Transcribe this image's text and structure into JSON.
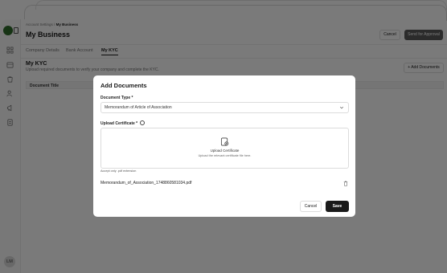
{
  "breadcrumb": {
    "parent": "Account Settings",
    "separator": "/",
    "current": "My Business"
  },
  "header": {
    "title": "My Business",
    "cancel_label": "Cancel",
    "approval_label": "Send for Approval"
  },
  "tabs": [
    {
      "label": "Company Details",
      "active": false
    },
    {
      "label": "Bank Account",
      "active": false
    },
    {
      "label": "My KYC",
      "active": true
    }
  ],
  "kyc": {
    "title": "My KYC",
    "subtitle": "Upload required documents to verify your company and complete the KYC.",
    "add_button": "+ Add Documents",
    "table_header": "Document Title"
  },
  "sidebar": {
    "icons": [
      "dashboard-icon",
      "box-icon",
      "bag-icon",
      "users-icon",
      "megaphone-icon",
      "document-icon"
    ],
    "avatar_initials": "LM"
  },
  "modal": {
    "title": "Add Documents",
    "doc_type_label": "Document Type *",
    "doc_type_value": "Memorandum of Article of Association",
    "upload_label": "Upload Certificate *",
    "upload_title": "Upload Certificate",
    "upload_sub": "Upload the relevant certificate file here.",
    "accept_note": "Accept only .pdf extension",
    "file_name": "Memorandum_of_Association_1748860581034.pdf",
    "cancel_label": "Cancel",
    "save_label": "Save"
  },
  "colors": {
    "logo": "#2f6b2a",
    "primary_button": "#1a1a1a",
    "overlay": "rgba(0,0,0,0.52)"
  }
}
